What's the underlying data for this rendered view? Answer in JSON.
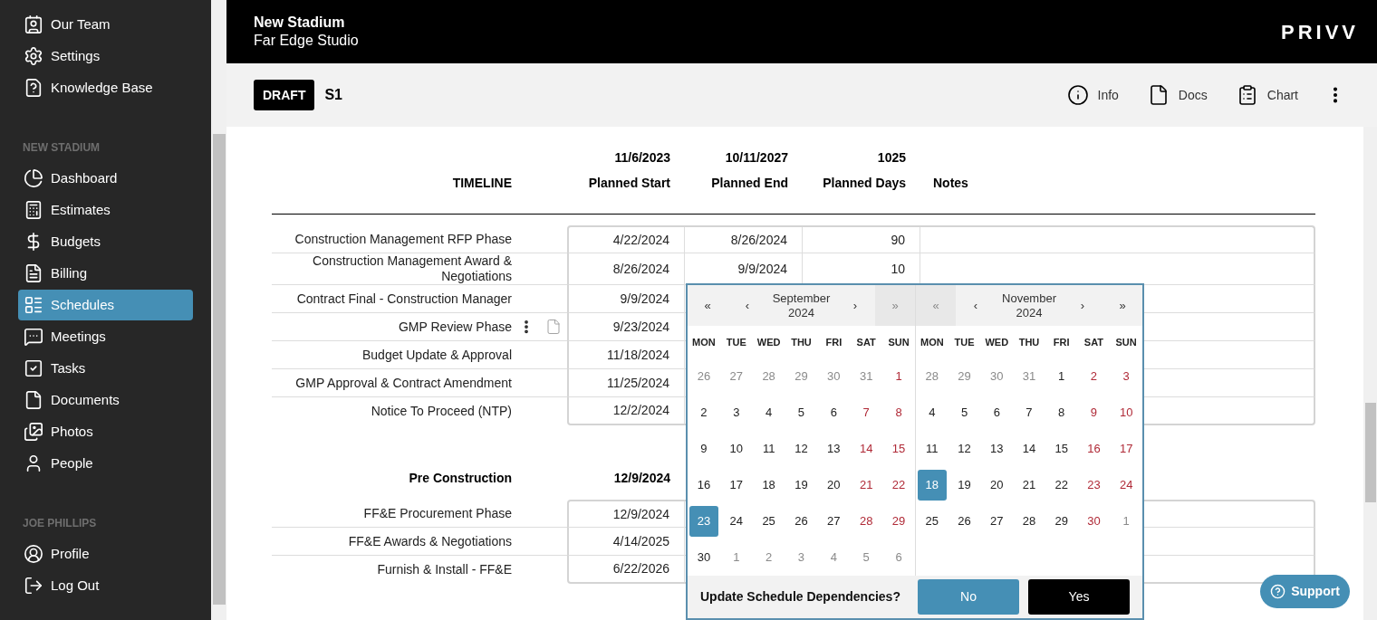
{
  "sidebar": {
    "groups": [
      {
        "items": [
          {
            "label": "Our Team",
            "selected": false
          },
          {
            "label": "Settings",
            "selected": false
          },
          {
            "label": "Knowledge Base",
            "selected": false
          }
        ]
      },
      {
        "heading": "NEW STADIUM",
        "items": [
          {
            "label": "Dashboard",
            "selected": false
          },
          {
            "label": "Estimates",
            "selected": false
          },
          {
            "label": "Budgets",
            "selected": false
          },
          {
            "label": "Billing",
            "selected": false
          },
          {
            "label": "Schedules",
            "selected": true
          },
          {
            "label": "Meetings",
            "selected": false
          },
          {
            "label": "Tasks",
            "selected": false
          },
          {
            "label": "Documents",
            "selected": false
          },
          {
            "label": "Photos",
            "selected": false
          },
          {
            "label": "People",
            "selected": false
          }
        ]
      },
      {
        "heading": "JOE PHILLIPS",
        "items": [
          {
            "label": "Profile",
            "selected": false
          },
          {
            "label": "Log Out",
            "selected": false
          }
        ]
      }
    ]
  },
  "header": {
    "project": "New Stadium",
    "company": "Far Edge Studio",
    "logo": "PRIVV"
  },
  "toolbar": {
    "status": "DRAFT",
    "schedule": "S1",
    "actions": [
      "Info",
      "Docs",
      "Chart"
    ]
  },
  "schedule": {
    "column_labels": [
      "Planned Start",
      "Planned End",
      "Planned Days",
      "Notes"
    ],
    "groups": [
      {
        "title": "TIMELINE",
        "start": "11/6/2023",
        "end": "10/11/2027",
        "days": "1025",
        "rows": [
          {
            "label": "Construction Management RFP Phase",
            "start": "4/22/2024",
            "end": "8/26/2024",
            "days": "90",
            "actions_visible": false
          },
          {
            "label": "Construction Management Award & Negotiations",
            "start": "8/26/2024",
            "end": "9/9/2024",
            "days": "10",
            "actions_visible": false
          },
          {
            "label": "Contract Final - Construction Manager",
            "start": "9/9/2024",
            "actions_visible": false
          },
          {
            "label": "GMP Review Phase",
            "start": "9/23/2024",
            "actions_visible": true
          },
          {
            "label": "Budget Update & Approval",
            "start": "11/18/2024",
            "actions_visible": false
          },
          {
            "label": "GMP Approval & Contract Amendment",
            "start": "11/25/2024",
            "actions_visible": false
          },
          {
            "label": "Notice To Proceed (NTP)",
            "start": "12/2/2024",
            "actions_visible": false
          }
        ]
      },
      {
        "title": "Pre Construction",
        "start": "12/9/2024",
        "rows": [
          {
            "label": "FF&E Procurement Phase",
            "start": "12/9/2024",
            "actions_visible": false
          },
          {
            "label": "FF&E Awards & Negotiations",
            "start": "4/14/2025",
            "actions_visible": false
          },
          {
            "label": "Furnish & Install - FF&E",
            "start": "6/22/2026",
            "actions_visible": false
          }
        ]
      }
    ]
  },
  "date_picker": {
    "months": [
      {
        "month": "September",
        "year": "2024",
        "nav": [
          {
            "symbol": "«",
            "disabled": false
          },
          {
            "symbol": "‹",
            "disabled": false
          },
          {
            "symbol": "›",
            "disabled": false
          },
          {
            "symbol": "»",
            "disabled": true
          }
        ],
        "weekdays": [
          "MON",
          "TUE",
          "WED",
          "THU",
          "FRI",
          "SAT",
          "SUN"
        ],
        "weeks": [
          [
            {
              "day": "26",
              "kind": "other",
              "selected": false
            },
            {
              "day": "27",
              "kind": "other",
              "selected": false
            },
            {
              "day": "28",
              "kind": "other",
              "selected": false
            },
            {
              "day": "29",
              "kind": "other",
              "selected": false
            },
            {
              "day": "30",
              "kind": "other",
              "selected": false
            },
            {
              "day": "31",
              "kind": "other",
              "selected": false
            },
            {
              "day": "1",
              "kind": "weekend",
              "selected": false
            }
          ],
          [
            {
              "day": "2",
              "kind": "weekday",
              "selected": false
            },
            {
              "day": "3",
              "kind": "weekday",
              "selected": false
            },
            {
              "day": "4",
              "kind": "weekday",
              "selected": false
            },
            {
              "day": "5",
              "kind": "weekday",
              "selected": false
            },
            {
              "day": "6",
              "kind": "weekday",
              "selected": false
            },
            {
              "day": "7",
              "kind": "weekend",
              "selected": false
            },
            {
              "day": "8",
              "kind": "weekend",
              "selected": false
            }
          ],
          [
            {
              "day": "9",
              "kind": "weekday",
              "selected": false
            },
            {
              "day": "10",
              "kind": "weekday",
              "selected": false
            },
            {
              "day": "11",
              "kind": "weekday",
              "selected": false
            },
            {
              "day": "12",
              "kind": "weekday",
              "selected": false
            },
            {
              "day": "13",
              "kind": "weekday",
              "selected": false
            },
            {
              "day": "14",
              "kind": "weekend",
              "selected": false
            },
            {
              "day": "15",
              "kind": "weekend",
              "selected": false
            }
          ],
          [
            {
              "day": "16",
              "kind": "weekday",
              "selected": false
            },
            {
              "day": "17",
              "kind": "weekday",
              "selected": false
            },
            {
              "day": "18",
              "kind": "weekday",
              "selected": false
            },
            {
              "day": "19",
              "kind": "weekday",
              "selected": false
            },
            {
              "day": "20",
              "kind": "weekday",
              "selected": false
            },
            {
              "day": "21",
              "kind": "weekend",
              "selected": false
            },
            {
              "day": "22",
              "kind": "weekend",
              "selected": false
            }
          ],
          [
            {
              "day": "23",
              "kind": "weekday",
              "selected": true
            },
            {
              "day": "24",
              "kind": "weekday",
              "selected": false
            },
            {
              "day": "25",
              "kind": "weekday",
              "selected": false
            },
            {
              "day": "26",
              "kind": "weekday",
              "selected": false
            },
            {
              "day": "27",
              "kind": "weekday",
              "selected": false
            },
            {
              "day": "28",
              "kind": "weekend",
              "selected": false
            },
            {
              "day": "29",
              "kind": "weekend",
              "selected": false
            }
          ],
          [
            {
              "day": "30",
              "kind": "weekday",
              "selected": false
            },
            {
              "day": "1",
              "kind": "other",
              "selected": false
            },
            {
              "day": "2",
              "kind": "other",
              "selected": false
            },
            {
              "day": "3",
              "kind": "other",
              "selected": false
            },
            {
              "day": "4",
              "kind": "other",
              "selected": false
            },
            {
              "day": "5",
              "kind": "other",
              "selected": false
            },
            {
              "day": "6",
              "kind": "other",
              "selected": false
            }
          ]
        ]
      },
      {
        "month": "November",
        "year": "2024",
        "nav": [
          {
            "symbol": "«",
            "disabled": true
          },
          {
            "symbol": "‹",
            "disabled": false
          },
          {
            "symbol": "›",
            "disabled": false
          },
          {
            "symbol": "»",
            "disabled": false
          }
        ],
        "weekdays": [
          "MON",
          "TUE",
          "WED",
          "THU",
          "FRI",
          "SAT",
          "SUN"
        ],
        "weeks": [
          [
            {
              "day": "28",
              "kind": "other",
              "selected": false
            },
            {
              "day": "29",
              "kind": "other",
              "selected": false
            },
            {
              "day": "30",
              "kind": "other",
              "selected": false
            },
            {
              "day": "31",
              "kind": "other",
              "selected": false
            },
            {
              "day": "1",
              "kind": "weekday",
              "selected": false
            },
            {
              "day": "2",
              "kind": "weekend",
              "selected": false
            },
            {
              "day": "3",
              "kind": "weekend",
              "selected": false
            }
          ],
          [
            {
              "day": "4",
              "kind": "weekday",
              "selected": false
            },
            {
              "day": "5",
              "kind": "weekday",
              "selected": false
            },
            {
              "day": "6",
              "kind": "weekday",
              "selected": false
            },
            {
              "day": "7",
              "kind": "weekday",
              "selected": false
            },
            {
              "day": "8",
              "kind": "weekday",
              "selected": false
            },
            {
              "day": "9",
              "kind": "weekend",
              "selected": false
            },
            {
              "day": "10",
              "kind": "weekend",
              "selected": false
            }
          ],
          [
            {
              "day": "11",
              "kind": "weekday",
              "selected": false
            },
            {
              "day": "12",
              "kind": "weekday",
              "selected": false
            },
            {
              "day": "13",
              "kind": "weekday",
              "selected": false
            },
            {
              "day": "14",
              "kind": "weekday",
              "selected": false
            },
            {
              "day": "15",
              "kind": "weekday",
              "selected": false
            },
            {
              "day": "16",
              "kind": "weekend",
              "selected": false
            },
            {
              "day": "17",
              "kind": "weekend",
              "selected": false
            }
          ],
          [
            {
              "day": "18",
              "kind": "weekday",
              "selected": true
            },
            {
              "day": "19",
              "kind": "weekday",
              "selected": false
            },
            {
              "day": "20",
              "kind": "weekday",
              "selected": false
            },
            {
              "day": "21",
              "kind": "weekday",
              "selected": false
            },
            {
              "day": "22",
              "kind": "weekday",
              "selected": false
            },
            {
              "day": "23",
              "kind": "weekend",
              "selected": false
            },
            {
              "day": "24",
              "kind": "weekend",
              "selected": false
            }
          ],
          [
            {
              "day": "25",
              "kind": "weekday",
              "selected": false
            },
            {
              "day": "26",
              "kind": "weekday",
              "selected": false
            },
            {
              "day": "27",
              "kind": "weekday",
              "selected": false
            },
            {
              "day": "28",
              "kind": "weekday",
              "selected": false
            },
            {
              "day": "29",
              "kind": "weekday",
              "selected": false
            },
            {
              "day": "30",
              "kind": "weekend",
              "selected": false
            },
            {
              "day": "1",
              "kind": "other",
              "selected": false
            }
          ]
        ]
      }
    ],
    "prompt": "Update Schedule Dependencies?",
    "buttons": [
      {
        "label": "No",
        "kind": "secondary"
      },
      {
        "label": "Yes",
        "kind": "primary"
      }
    ]
  },
  "support": {
    "label": "Support"
  }
}
